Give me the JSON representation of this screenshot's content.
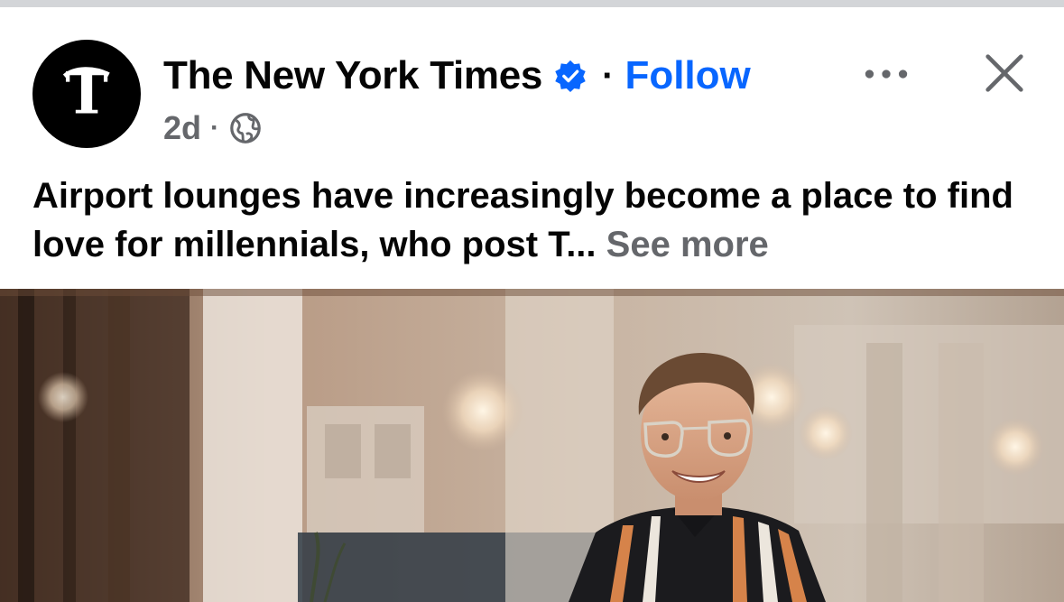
{
  "post": {
    "author": "The New York Times",
    "verified": true,
    "separator": "·",
    "follow_label": "Follow",
    "timestamp": "2d",
    "meta_separator": "·",
    "audience_icon": "globe-icon",
    "caption": "Airport lounges have increasingly become a place to find love for millennials, who post T...",
    "see_more_label": "See more",
    "more_icon": "more-options-icon",
    "close_icon": "close-icon"
  },
  "colors": {
    "accent": "#0866ff",
    "secondary_text": "#65676b",
    "primary_text": "#050505",
    "strip": "#d3d5d8"
  }
}
